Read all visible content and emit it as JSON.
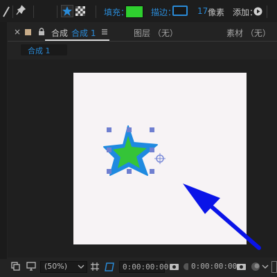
{
  "toolbar": {
    "fill_label": "填充：",
    "stroke_label": "描边：",
    "stroke_width": "17",
    "stroke_unit": "像素",
    "add_label": "添加：",
    "fill_color": "#2fcf2f",
    "stroke_color": "#2a8bd8",
    "icons": [
      "pen-icon",
      "pin-icon",
      "star-tool-icon",
      "checker-icon",
      "play-icon"
    ]
  },
  "panel": {
    "close_glyph": "×",
    "tab_prefix": "合成",
    "tab_name": "合成 1",
    "layer_label": "图层 （无）",
    "footage_label": "素材 （无）",
    "sub_tab": "合成 1"
  },
  "canvas": {
    "background": "#f7f3f5",
    "star_fill": "#35c438",
    "star_stroke": "#1f8ae0"
  },
  "bottom": {
    "zoom": "(50%)",
    "timecode_1": "0:00:00:00",
    "timecode_2": "0:00:00:00"
  },
  "annotation": {
    "arrow_color": "#0a14e8"
  }
}
